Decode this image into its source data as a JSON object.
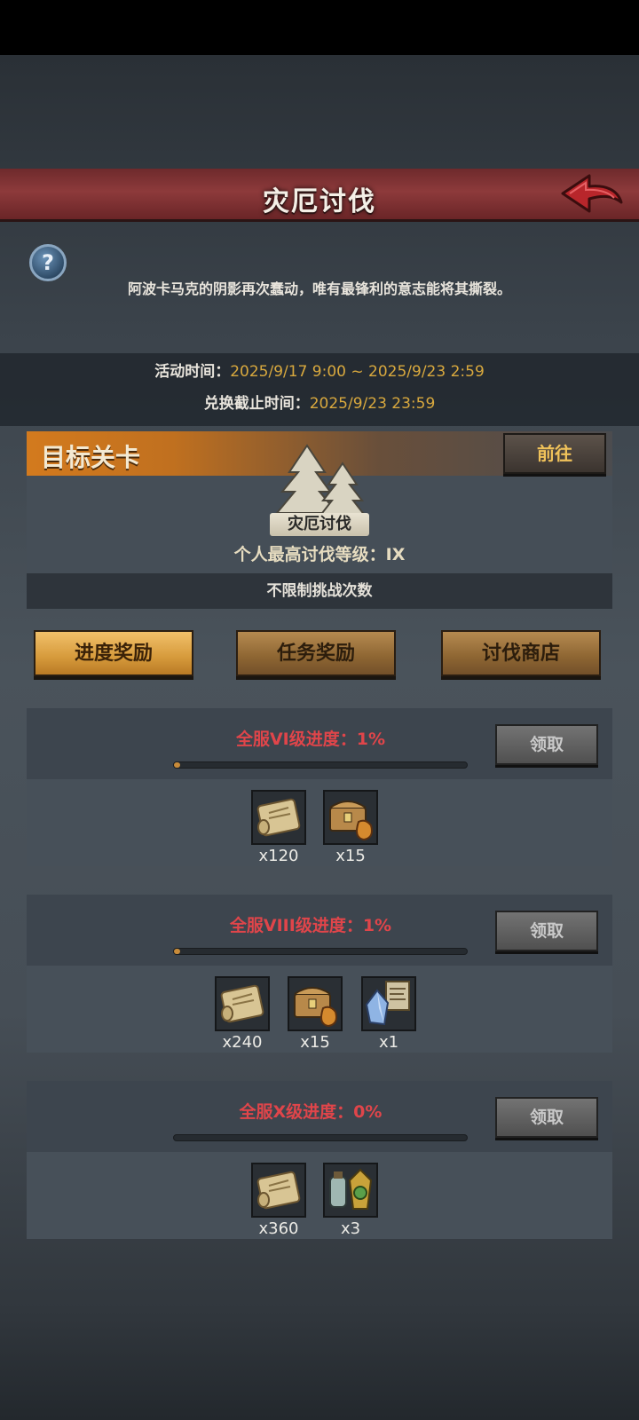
{
  "header": {
    "title": "灾厄讨伐"
  },
  "description": "阿波卡马克的阴影再次蠢动，唯有最锋利的意志能将其撕裂。",
  "time": {
    "activity_label": "活动时间：",
    "activity_value": "2025/9/17 9:00 ~ 2025/9/23 2:59",
    "exchange_label": "兑换截止时间：",
    "exchange_value": "2025/9/23 23:59"
  },
  "target": {
    "title": "目标关卡",
    "goto_label": "前往",
    "stage_name": "灾厄讨伐",
    "best_level": "个人最高讨伐等级：IX",
    "attempts": "不限制挑战次数"
  },
  "tabs": [
    {
      "label": "进度奖励",
      "active": true
    },
    {
      "label": "任务奖励",
      "active": false
    },
    {
      "label": "讨伐商店",
      "active": false
    }
  ],
  "rewards": [
    {
      "title": "全服VI级进度：1%",
      "progress": 0.01,
      "claim_label": "领取",
      "items": [
        {
          "icon": "scroll-icon",
          "qty": "x120"
        },
        {
          "icon": "chest-icon",
          "qty": "x15"
        }
      ]
    },
    {
      "title": "全服VIII级进度：1%",
      "progress": 0.01,
      "claim_label": "领取",
      "items": [
        {
          "icon": "scroll-icon",
          "qty": "x240"
        },
        {
          "icon": "chest-icon",
          "qty": "x15"
        },
        {
          "icon": "crystal-icon",
          "qty": "x1"
        }
      ]
    },
    {
      "title": "全服X级进度：0%",
      "progress": 0.0,
      "claim_label": "领取",
      "items": [
        {
          "icon": "scroll-icon",
          "qty": "x360"
        },
        {
          "icon": "potion-icon",
          "qty": "x3"
        }
      ]
    }
  ],
  "colors": {
    "accent_orange": "#d37a1e",
    "progress_red": "#e0454a",
    "time_gold": "#d9a93e",
    "header_red": "#8d3a3b"
  }
}
